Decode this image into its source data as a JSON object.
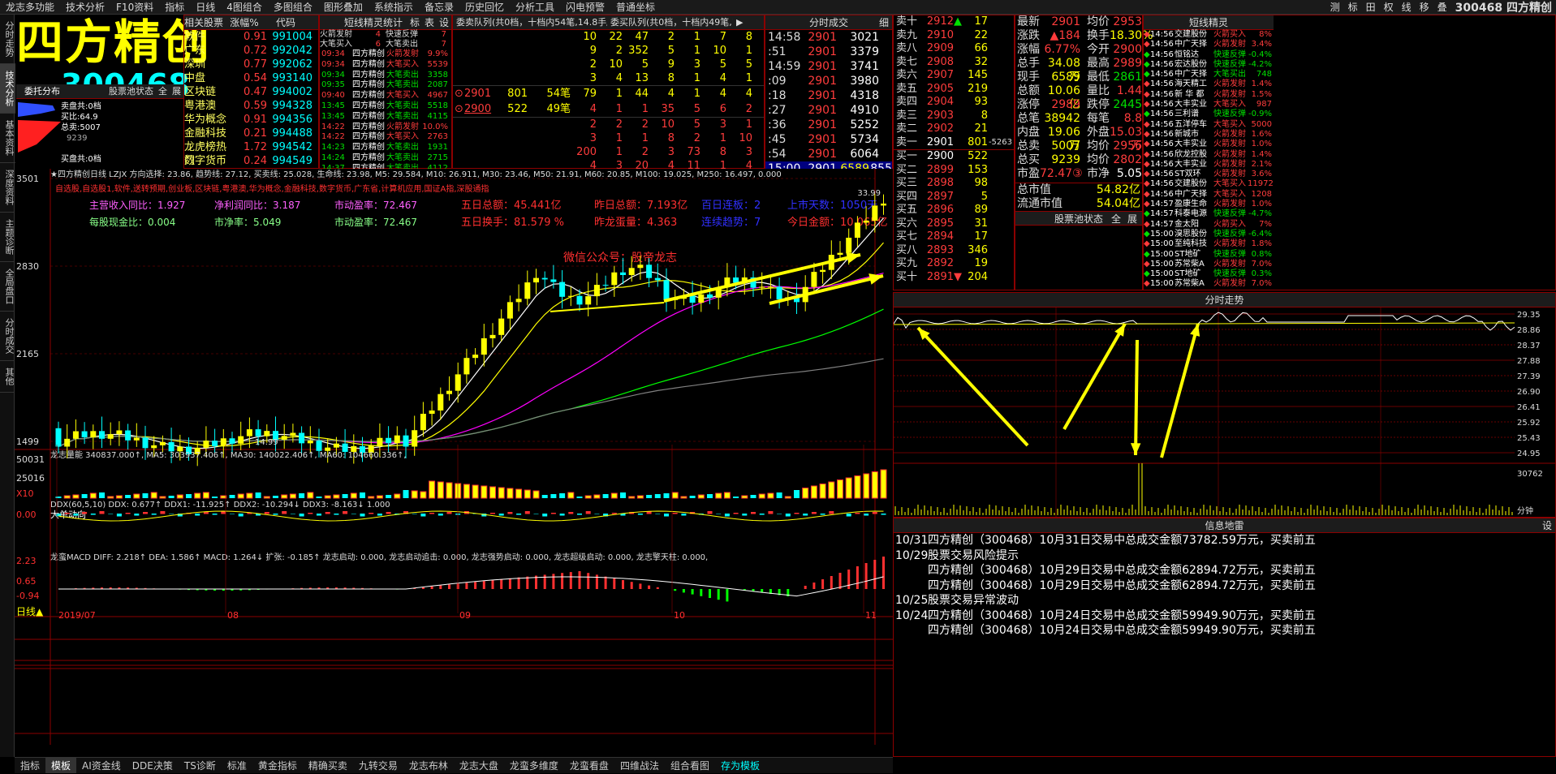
{
  "menu": {
    "items": [
      "龙志多功能",
      "技术分析",
      "F10资料",
      "指标",
      "日线",
      "4图组合",
      "多图组合",
      "图形叠加",
      "系统指示",
      "备忘录",
      "历史回忆",
      "分析工具",
      "闪电预警",
      "普通坐标"
    ],
    "right_icons": [
      "测",
      "标",
      "田",
      "权",
      "线",
      "移",
      "叠"
    ],
    "stock_title": "300468 四方精创"
  },
  "left_tabs": [
    "分时走势",
    "技术分析",
    "基本资料",
    "深度资料",
    "主题诊断",
    "全局盘口",
    "分时成交",
    "其他"
  ],
  "stock": {
    "name": "四方精创",
    "code": "300468"
  },
  "dist": {
    "title": "委托分布",
    "tab": "股票池状态",
    "btn1": "全",
    "btn2": "展",
    "sell_total": "卖盘共:0档",
    "buy_pct": "买比:64.9",
    "total_sell": "总卖:5007",
    "buy_total": "买盘共:0档",
    "val1": "9239"
  },
  "related": {
    "headers": [
      "相关股票",
      "涨幅%",
      "代码"
    ],
    "rows": [
      {
        "name": "软件",
        "chg": "0.91",
        "code": "991004"
      },
      {
        "name": "广东",
        "chg": "0.72",
        "code": "992042"
      },
      {
        "name": "深圳",
        "chg": "0.77",
        "code": "992062"
      },
      {
        "name": "中盘",
        "chg": "0.54",
        "code": "993140"
      },
      {
        "name": "区块链",
        "chg": "0.47",
        "code": "994002"
      },
      {
        "name": "粤港澳",
        "chg": "0.59",
        "code": "994328"
      },
      {
        "name": "华为概念",
        "chg": "0.91",
        "code": "994356"
      },
      {
        "name": "金融科技",
        "chg": "0.21",
        "code": "994488"
      },
      {
        "name": "龙虎榜热门",
        "chg": "1.72",
        "code": "994542"
      },
      {
        "name": "数字货币",
        "chg": "0.24",
        "code": "994549"
      }
    ]
  },
  "spirit": {
    "title": "短线精灵统计",
    "tabs": [
      "标",
      "表",
      "设"
    ],
    "cats": [
      [
        "火箭发射",
        "4"
      ],
      [
        "快速反弹",
        "7"
      ],
      [
        "大笔买入",
        "6"
      ],
      [
        "大笔卖出",
        "7"
      ]
    ],
    "rows": [
      [
        "09:34",
        "四方精创",
        "火箭发射",
        "9.9%"
      ],
      [
        "09:34",
        "四方精创",
        "大笔买入",
        "5539"
      ],
      [
        "09:34",
        "四方精创",
        "大笔卖出",
        "3358"
      ],
      [
        "09:35",
        "四方精创",
        "大笔卖出",
        "2087"
      ],
      [
        "09:40",
        "四方精创",
        "大笔买入",
        "4967"
      ],
      [
        "13:45",
        "四方精创",
        "大笔卖出",
        "5518"
      ],
      [
        "13:45",
        "四方精创",
        "大笔卖出",
        "4115"
      ],
      [
        "14:22",
        "四方精创",
        "火箭发射",
        "10.0%"
      ],
      [
        "14:22",
        "四方精创",
        "大笔买入",
        "2763"
      ],
      [
        "14:23",
        "四方精创",
        "大笔卖出",
        "1931"
      ],
      [
        "14:24",
        "四方精创",
        "大笔卖出",
        "2715"
      ],
      [
        "14:37",
        "四方精创",
        "大笔卖出",
        "4112"
      ]
    ]
  },
  "queue": {
    "sell_title": "委卖队列(共0档，十档内54笔,14.8手/笔)",
    "buy_title": "委买队列(共0档，十档内49笔,10",
    "sell_rows": [
      [
        "10",
        "22",
        "47",
        "2",
        "1",
        "7",
        "8"
      ],
      [
        "9",
        "2",
        "352",
        "5",
        "1",
        "10",
        "1"
      ],
      [
        "2",
        "10",
        "5",
        "9",
        "3",
        "5",
        "5"
      ],
      [
        "3",
        "4",
        "13",
        "8",
        "1",
        "4",
        "1"
      ]
    ],
    "sell_row": {
      "price": "2901",
      "vol": "801",
      "cnt": "54笔",
      "vals": [
        "79",
        "1",
        "44",
        "4",
        "1",
        "4",
        "4"
      ]
    },
    "buy_row": {
      "price": "2900",
      "vol": "522",
      "cnt": "49笔",
      "vals": [
        "4",
        "1",
        "1",
        "35",
        "5",
        "6",
        "2"
      ]
    },
    "buy_rows": [
      [
        "2",
        "2",
        "2",
        "10",
        "5",
        "3",
        "1"
      ],
      [
        "3",
        "1",
        "1",
        "8",
        "2",
        "1",
        "10"
      ],
      [
        "200",
        "1",
        "2",
        "3",
        "73",
        "8",
        "3"
      ],
      [
        "4",
        "3",
        "20",
        "4",
        "11",
        "1",
        "4"
      ]
    ]
  },
  "ticks": {
    "title": "分时成交",
    "btn": "细",
    "rows": [
      [
        "14:58",
        "2901",
        "3021"
      ],
      [
        ":51",
        "2901",
        "3379"
      ],
      [
        "14:59",
        "2901",
        "3741"
      ],
      [
        ":09",
        "2901",
        "3980"
      ],
      [
        ":18",
        "2901",
        "4318"
      ],
      [
        ":27",
        "2901",
        "4910"
      ],
      [
        ":36",
        "2901",
        "5252"
      ],
      [
        ":45",
        "2901",
        "5734"
      ],
      [
        ":54",
        "2901",
        "6064"
      ]
    ],
    "last": [
      "15:00",
      "2901",
      "6589",
      "855"
    ]
  },
  "orderbook": {
    "sell": [
      [
        "卖十",
        "2912",
        "17",
        "▲"
      ],
      [
        "卖九",
        "2910",
        "22",
        ""
      ],
      [
        "卖八",
        "2909",
        "66",
        ""
      ],
      [
        "卖七",
        "2908",
        "32",
        ""
      ],
      [
        "卖六",
        "2907",
        "145",
        ""
      ],
      [
        "卖五",
        "2905",
        "219",
        ""
      ],
      [
        "卖四",
        "2904",
        "93",
        ""
      ],
      [
        "卖三",
        "2903",
        "8",
        ""
      ],
      [
        "卖二",
        "2902",
        "21",
        ""
      ],
      [
        "卖一",
        "2901",
        "801",
        "-5263"
      ]
    ],
    "buy": [
      [
        "买一",
        "2900",
        "522",
        ""
      ],
      [
        "买二",
        "2899",
        "153",
        ""
      ],
      [
        "买三",
        "2898",
        "98",
        ""
      ],
      [
        "买四",
        "2897",
        "5",
        ""
      ],
      [
        "买五",
        "2896",
        "89",
        ""
      ],
      [
        "买六",
        "2895",
        "31",
        ""
      ],
      [
        "买七",
        "2894",
        "17",
        ""
      ],
      [
        "买八",
        "2893",
        "346",
        ""
      ],
      [
        "买九",
        "2892",
        "19",
        ""
      ],
      [
        "买十",
        "2891",
        "204",
        "▼"
      ]
    ]
  },
  "quote": {
    "rows": [
      [
        "最新",
        "2901",
        "均价",
        "2953"
      ],
      [
        "涨跌",
        "▲184",
        "换手",
        "18.30%"
      ],
      [
        "涨幅",
        "6.77%",
        "今开",
        "2900"
      ],
      [
        "总手",
        "34.08万",
        "最高",
        "2989"
      ],
      [
        "现手",
        "6589",
        "最低",
        "2861"
      ],
      [
        "总额",
        "10.06亿",
        "量比",
        "1.44"
      ],
      [
        "涨停",
        "2989",
        "跌停",
        "2445"
      ],
      [
        "总笔",
        "38942",
        "每笔",
        "8.8"
      ],
      [
        "内盘",
        "19.06万",
        "外盘",
        "15.03万"
      ],
      [
        "总卖",
        "5007",
        "均价",
        "2956"
      ],
      [
        "总买",
        "9239",
        "均价",
        "2802"
      ],
      [
        "市盈",
        "72.47③",
        "市净",
        "5.05"
      ]
    ],
    "cap": [
      [
        "总市值",
        "54.82亿"
      ],
      [
        "流通市值",
        "54.04亿"
      ]
    ],
    "pool_title": "股票池状态",
    "pool_btns": [
      "全",
      "展"
    ]
  },
  "spirit2": {
    "title": "短线精灵",
    "rows": [
      [
        "14:56",
        "交建股份",
        "火箭买入",
        "8%"
      ],
      [
        "14:56",
        "中广天择",
        "火箭发射",
        "3.4%"
      ],
      [
        "14:56",
        "恒铭达",
        "快速反弹",
        "-0.4%"
      ],
      [
        "14:56",
        "宏达股份",
        "快速反弹",
        "-4.2%"
      ],
      [
        "14:56",
        "中广天择",
        "大笔买出",
        "748"
      ],
      [
        "14:56",
        "海天精工",
        "火箭发射",
        "1.4%"
      ],
      [
        "14:56",
        "新 华 都",
        "火箭发射",
        "1.5%"
      ],
      [
        "14:56",
        "大丰实业",
        "大笔买入",
        "987"
      ],
      [
        "14:56",
        "三利谱",
        "快速反弹",
        "-0.9%"
      ],
      [
        "14:56",
        "五洋停车",
        "大笔买入",
        "5000"
      ],
      [
        "14:56",
        "新城市",
        "火箭发射",
        "1.6%"
      ],
      [
        "14:56",
        "大丰实业",
        "火箭发射",
        "1.0%"
      ],
      [
        "14:56",
        "欣龙控股",
        "火箭发射",
        "1.4%"
      ],
      [
        "14:56",
        "大丰实业",
        "火箭发射",
        "2.1%"
      ],
      [
        "14:56",
        "ST双环",
        "火箭发射",
        "3.6%"
      ],
      [
        "14:56",
        "交建股份",
        "大笔买入",
        "11972"
      ],
      [
        "14:56",
        "中广天择",
        "大笔买入",
        "1208"
      ],
      [
        "14:57",
        "盈康生命",
        "火箭发射",
        "1.0%"
      ],
      [
        "14:57",
        "科泰电源",
        "快速反弹",
        "-4.7%"
      ],
      [
        "14:57",
        "金太阳",
        "火箭买入",
        "7%"
      ],
      [
        "15:00",
        "溴思股份",
        "快速反弹",
        "-6.4%"
      ],
      [
        "15:00",
        "至纯科技",
        "火箭发射",
        "1.8%"
      ],
      [
        "15:00",
        "ST地矿",
        "快速反弹",
        "0.8%"
      ],
      [
        "15:00",
        "苏常柴A",
        "火箭发射",
        "7.0%"
      ],
      [
        "15:00",
        "ST地矿",
        "快速反弹",
        "0.3%"
      ],
      [
        "15:00",
        "苏常柴A",
        "火箭发射",
        "7.0%"
      ]
    ]
  },
  "intraday": {
    "title": "分时走势",
    "y_labels": [
      "29.35",
      "28.86",
      "28.37",
      "27.88",
      "27.39",
      "26.90",
      "26.41",
      "25.92",
      "25.43",
      "24.95"
    ],
    "vol_labels": [
      "30762",
      "分钟"
    ]
  },
  "info": {
    "title": "信息地雷",
    "btn": "设",
    "rows": [
      [
        "10/31",
        "四方精创（300468）10月31日交易中总成交金额73782.59万元，买卖前五"
      ],
      [
        "10/29",
        "股票交易风险提示"
      ],
      [
        "",
        "四方精创（300468）10月29日交易中总成交金额62894.72万元，买卖前五"
      ],
      [
        "",
        "四方精创（300468）10月29日交易中总成交金额62894.72万元，买卖前五"
      ],
      [
        "10/25",
        "股票交易异常波动"
      ],
      [
        "10/24",
        "四方精创（300468）10月24日交易中总成交金额59949.90万元，买卖前五"
      ],
      [
        "",
        "四方精创（300468）10月24日交易中总成交金额59949.90万元，买卖前五"
      ]
    ]
  },
  "kline": {
    "header": "★四方精创日线  LZJX  方向选择: 23.86, 趋势线: 27.12, 买卖线: 25.028, 生命线: 23.98, M5: 29.584, M10: 26.911, M30: 23.46, M50: 21.91, M60: 20.85, M100: 19.025, M250: 16.497, 0.000",
    "concepts": "自选股,自选股1,软件,送转预期,创业板,区块链,粤港澳,华为概念,金融科技,数字货币,广东省,计算机应用,国证A指,深股通指",
    "fund": [
      [
        "主营收入同比：1.927",
        "净利润同比：3.187",
        "市动盈率：72.467"
      ],
      [
        "每股现金比：0.004",
        "市净率：5.049",
        "市动盈率：72.467"
      ]
    ],
    "stats": [
      [
        "五日总额：45.441亿",
        "昨日总额：7.193亿",
        "百日连板：2",
        "上市天数：1050天"
      ],
      [
        "五日换手：81.579 %",
        "昨龙蛋量：4.363",
        "连续趋势：7",
        "今日金额：10.065亿"
      ]
    ],
    "watermark": "微信公众号：股帝龙志",
    "y_labels": [
      "3501",
      "2830",
      "2165",
      "1499"
    ],
    "hi_label": "33.99",
    "lo_label": "14.99",
    "x_labels": [
      "2019/07",
      "08",
      "09",
      "10",
      "11"
    ]
  },
  "vol": {
    "header": "龙志量能  340837.000↑, MA5: 303937.406↑, MA30: 140022.406↑, MA60: 104660.336↑,",
    "y_labels": [
      "50031",
      "25016",
      "X10"
    ]
  },
  "ddx": {
    "header": "DDX(60,5,10) DDX: 0.677↑  DDX1: -11.925↑ DDX2: -10.294↓ DDX3: -8.163↓ 1.000",
    "label": "大单动向",
    "y_labels": [
      "0.00"
    ]
  },
  "macd": {
    "header": "龙蛮MACD  DIFF: 2.218↑ DEA: 1.586↑ MACD: 1.264↓ 扩张: -0.185↑ 龙志启动: 0.000, 龙志启动追击: 0.000, 龙志强势启动: 0.000, 龙志超级启动: 0.000, 龙志擎天柱: 0.000,",
    "y_labels": [
      "2.23",
      "0.65",
      "-0.94"
    ],
    "period": "日线▲"
  },
  "bottom_tabs": [
    "指标",
    "模板",
    "AI资金线",
    "DDE决策",
    "TS诊断",
    "标准",
    "黄金指标",
    "精确买卖",
    "九转交易",
    "龙志布林",
    "龙志大盘",
    "龙蛮多维度",
    "龙蛮看盘",
    "四维战法",
    "组合看图",
    "存为模板"
  ]
}
